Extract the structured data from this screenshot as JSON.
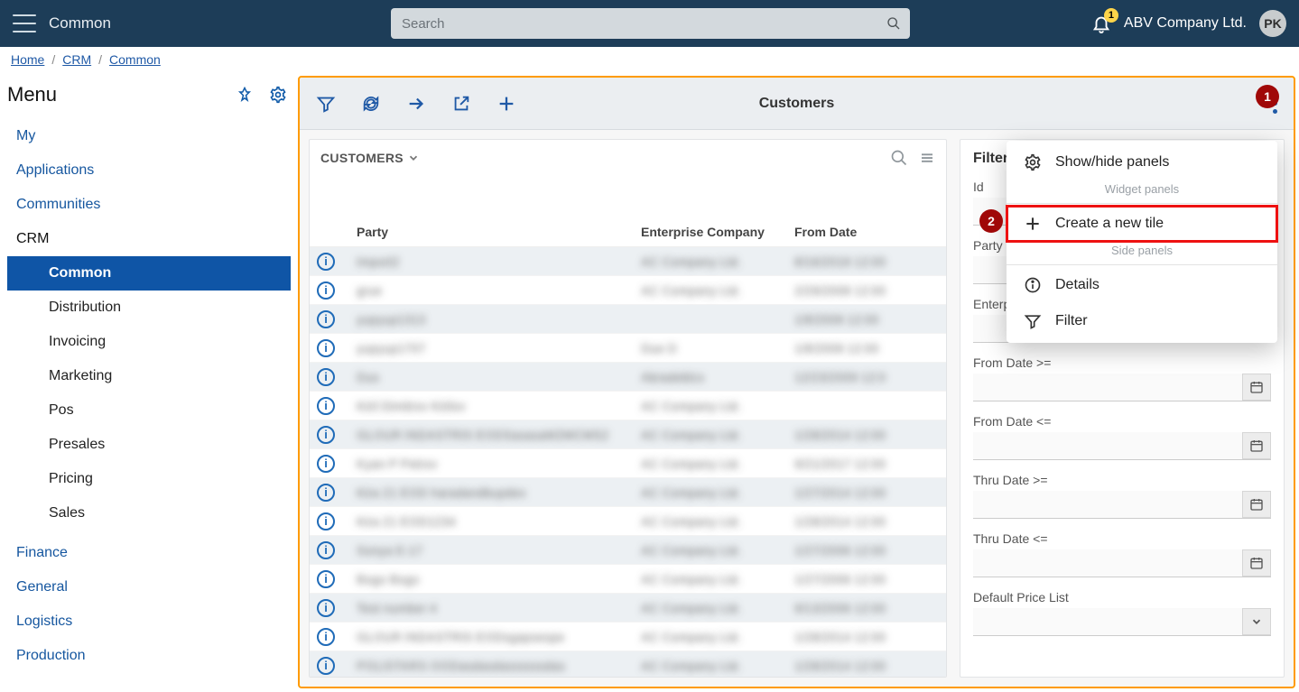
{
  "topbar": {
    "context": "Common",
    "search_placeholder": "Search",
    "notification_count": "1",
    "company_name": "ABV Company Ltd.",
    "avatar_initials": "PK"
  },
  "breadcrumb": {
    "home": "Home",
    "crm": "CRM",
    "common": "Common"
  },
  "menu": {
    "title": "Menu",
    "items": [
      "My",
      "Applications",
      "Communities"
    ],
    "crm_label": "CRM",
    "crm_children": [
      "Common",
      "Distribution",
      "Invoicing",
      "Marketing",
      "Pos",
      "Presales",
      "Pricing",
      "Sales"
    ],
    "rest": [
      "Finance",
      "General",
      "Logistics",
      "Production"
    ]
  },
  "toolbar": {
    "title": "Customers"
  },
  "grid": {
    "title": "CUSTOMERS",
    "cols": {
      "party": "Party",
      "enterprise": "Enterprise Company",
      "from": "From Date"
    },
    "rows": [
      {
        "party": "Import2",
        "company": "AC Company Ltd.",
        "date": "8/16/2018 12:00"
      },
      {
        "party": "grue",
        "company": "AC Company Ltd.",
        "date": "2/29/2008 12:00"
      },
      {
        "party": "yupyup1313",
        "company": "",
        "date": "1/8/2008 12:00"
      },
      {
        "party": "yupyup1707",
        "company": "Due D",
        "date": "1/8/2008 12:00"
      },
      {
        "party": "Dus",
        "company": "Abradeblcs",
        "date": "12/23/2009 12:0"
      },
      {
        "party": "Kiril Dimitrov Kirilov",
        "company": "AC Company Ltd.",
        "date": ""
      },
      {
        "party": "GLOUR INDASTRIS EODSasasaM2MCMS2",
        "company": "AC Company Ltd.",
        "date": "1/28/2014 12:00"
      },
      {
        "party": "Kyan P Petrov",
        "company": "AC Company Ltd.",
        "date": "9/21/2017 12:00"
      },
      {
        "party": "Kira 21 EOD haradandbupdex",
        "company": "AC Company Ltd.",
        "date": "1/27/2014 12:00"
      },
      {
        "party": "Kira 21 EOD1234",
        "company": "AC Company Ltd.",
        "date": "1/28/2014 12:00"
      },
      {
        "party": "Sonya E-17",
        "company": "AC Company Ltd.",
        "date": "1/27/2006 12:00"
      },
      {
        "party": "Bogo Bogo",
        "company": "AC Company Ltd.",
        "date": "1/27/2006 12:00"
      },
      {
        "party": "Test number 4",
        "company": "AC Company Ltd.",
        "date": "9/13/2006 12:00"
      },
      {
        "party": "GLOUR INDASTRIS EODsgapsespe",
        "company": "AC Company Ltd.",
        "date": "1/28/2014 12:00"
      },
      {
        "party": "POLISTARS OODasdasdassssssdas",
        "company": "AC Company Ltd.",
        "date": "1/28/2014 12:00"
      }
    ]
  },
  "filter": {
    "title": "Filter",
    "fields": {
      "id": "Id",
      "party": "Party",
      "enterprise": "Enterprise Company",
      "from_ge": "From Date >=",
      "from_le": "From Date <=",
      "thru_ge": "Thru Date >=",
      "thru_le": "Thru Date <=",
      "default_price_list": "Default Price List"
    }
  },
  "popup": {
    "show_hide": "Show/hide panels",
    "widget_panels": "Widget panels",
    "create_tile": "Create a new tile",
    "side_panels": "Side panels",
    "details": "Details",
    "filter": "Filter"
  },
  "annotations": {
    "one": "1",
    "two": "2"
  }
}
